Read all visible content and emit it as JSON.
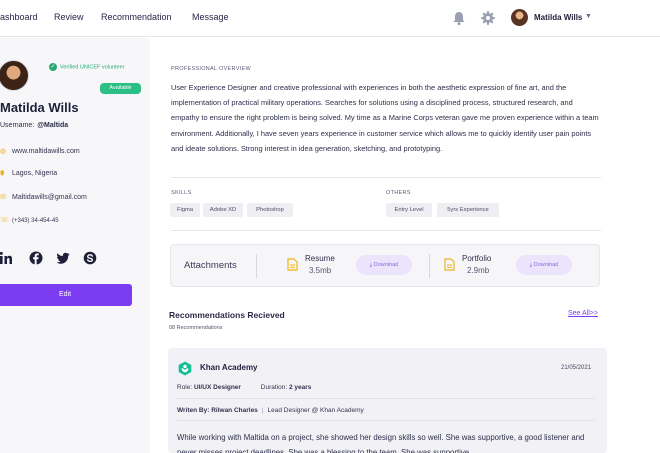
{
  "nav": {
    "items": [
      {
        "label": "ashboard"
      },
      {
        "label": "Review"
      },
      {
        "label": "Recommendation"
      },
      {
        "label": "Message"
      }
    ],
    "user_name": "Matilda Wills"
  },
  "profile": {
    "verified_text": "Verified UNICEF volunteer",
    "available_badge": "Available",
    "name": "Matilda Wills",
    "username_label": "Username:",
    "username_value": "@Maltida",
    "website": "www.maltidawills.com",
    "location": "Lagos, Nigeria",
    "email": "Maltidawills@gmail.com",
    "phone": "(+343) 34-454-45",
    "edit_label": "Edit",
    "social_icons": [
      "linkedin-icon",
      "facebook-icon",
      "twitter-icon",
      "skype-icon"
    ],
    "accent_color": "#7b3cf2",
    "contact_icon_color": "#f0b41c"
  },
  "overview": {
    "heading": "PROFESSIONAL OVERVIEW",
    "text": "User Experience Designer and creative professional with experiences in both the aesthetic expression of fine art, and the implementation of practical military operations. Searches for solutions using a disciplined process, structured research, and empathy to ensure the right problem is being solved. My time as a Marine Corps veteran gave me proven experience within a team environment. Additionally, I have seven years experience in customer service which allows me to quickly identify user pain points and ideate solutions. Strong interest in idea generation, sketching, and prototyping."
  },
  "skills": {
    "heading": "SKILLS",
    "tags": [
      "Figma",
      "Adobe XD",
      "Photoshop"
    ]
  },
  "others": {
    "heading": "OTHERS",
    "tags": [
      "Entry Level",
      "5yrs Experience"
    ]
  },
  "attachments": {
    "title": "Attachments",
    "files": [
      {
        "name": "Resume",
        "size": "3.5mb",
        "download_label": "Download"
      },
      {
        "name": "Portfolio",
        "size": "2.9mb",
        "download_label": "Download"
      }
    ]
  },
  "recommendations": {
    "title": "Recommendations Recieved",
    "count": "08 Recommendations",
    "see_all": "See All>>",
    "items": [
      {
        "org": "Khan Academy",
        "date": "21/05/2021",
        "role_label": "Role:",
        "role_value": "UI/UX Designer",
        "duration_label": "Duration:",
        "duration_value": "2 years",
        "written_label": "Writen By:",
        "written_by": "Rilwan Charles",
        "written_role": "Lead Designer @ Khan Academy",
        "text": "While working with Maltida on a project, she showed her design skills so well. She was supportive, a good listener and never misses project deadlines. She was a blessing to the team. She was supportive,"
      }
    ]
  }
}
